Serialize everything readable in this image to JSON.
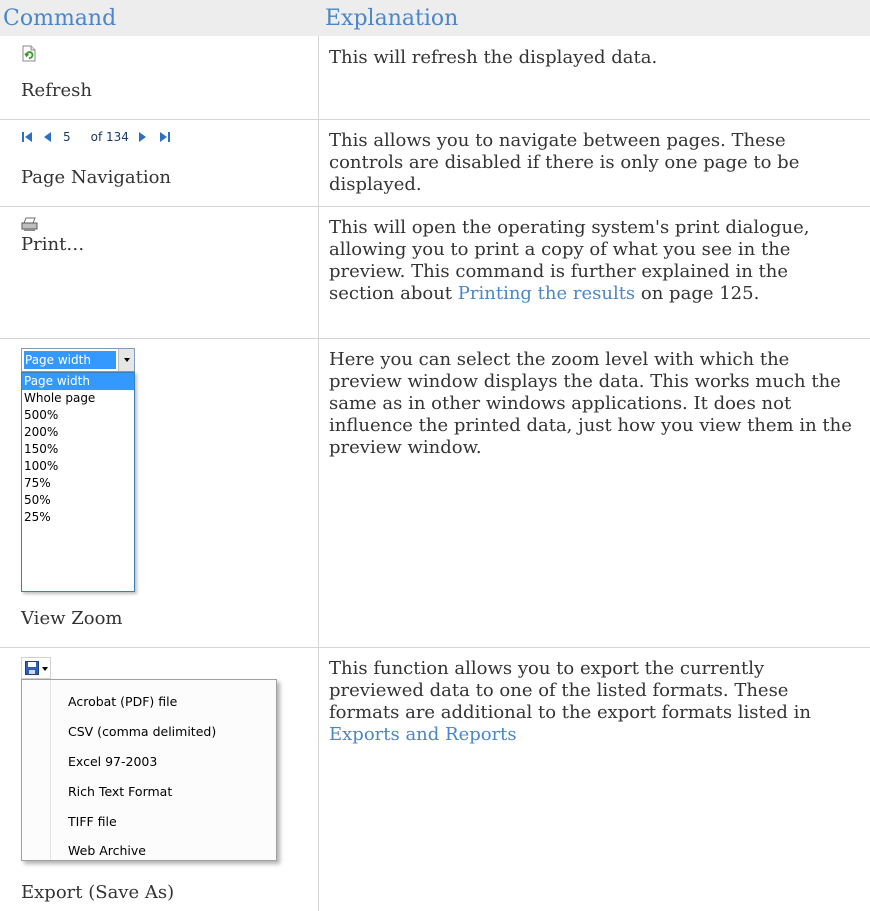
{
  "header": {
    "command": "Command",
    "explanation": "Explanation"
  },
  "rows": [
    {
      "command": "Refresh",
      "explanation": "This will refresh the displayed data."
    },
    {
      "command": "Page Navigation",
      "nav": {
        "current_page": "5",
        "of_label": "of 134"
      },
      "explanation": "This allows you to navigate between pages. These controls are disabled if there is only one page to be displayed."
    },
    {
      "command": "Print…",
      "explanation_pre": "This will open the operating system's print dialogue, allowing you to print a copy of what you see in the preview. This command is further explained in the section about ",
      "link": "Printing the results",
      "explanation_post": " on page 125."
    },
    {
      "command": "View Zoom",
      "zoom": {
        "selected": "Page width",
        "options": [
          "Page width",
          "Whole page",
          "500%",
          "200%",
          "150%",
          "100%",
          "75%",
          "50%",
          "25%"
        ]
      },
      "explanation": "Here you can select the zoom level with which the preview window displays the data. This works much the same as in other windows applications. It does not influence the printed data, just how you view them in the preview window."
    },
    {
      "command": "Export (Save As)",
      "export": {
        "options": [
          "Acrobat (PDF) file",
          "CSV (comma delimited)",
          "Excel 97-2003",
          "Rich Text Format",
          "TIFF file",
          "Web Archive"
        ]
      },
      "explanation_pre": "This function allows you to export the currently previewed data to one of the listed formats. These formats are additional to the export formats listed in ",
      "link": "Exports and Reports",
      "explanation_post": ""
    }
  ],
  "colors": {
    "heading": "#4a86c8",
    "link": "#4a86c8",
    "header_bg": "#ededed",
    "text": "#333333",
    "selection": "#3399ff"
  }
}
